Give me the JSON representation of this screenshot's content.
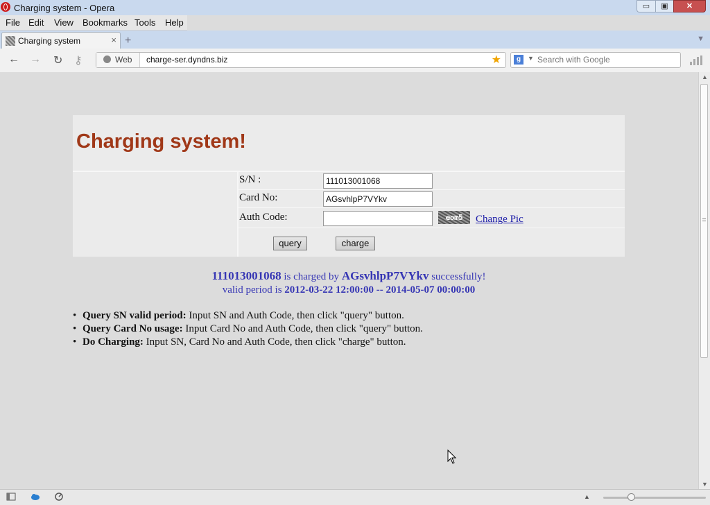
{
  "window": {
    "title": "Charging system - Opera",
    "minimize": "▭",
    "maximize": "▣",
    "close": "✕"
  },
  "menu": [
    "File",
    "Edit",
    "View",
    "Bookmarks",
    "Tools",
    "Help"
  ],
  "tab": {
    "title": "Charging system",
    "close": "×",
    "new_tab": "+"
  },
  "toolbar": {
    "back": "←",
    "forward": "→",
    "reload": "↻",
    "key": "⚷",
    "web_label": "Web",
    "url": "charge-ser.dyndns.biz",
    "star": "★",
    "search_engine": "g",
    "search_placeholder": "Search with Google"
  },
  "page": {
    "heading": "Charging system!",
    "form": {
      "sn_label": "S/N :",
      "sn_value": "111013001068",
      "card_label": "Card No:",
      "card_value": "AGsvhlpP7VYkv",
      "auth_label": "Auth Code:",
      "auth_value": "",
      "captcha_text": "eom5",
      "change_pic": "Change Pic",
      "query_button": "query",
      "charge_button": "charge"
    },
    "result": {
      "sn": "111013001068",
      "charged_by": "is charged by",
      "card": "AGsvhlpP7VYkv",
      "success": "successfully!",
      "valid_prefix": "valid period is",
      "valid_from": "2012-03-22 12:00:00",
      "valid_sep": "--",
      "valid_to": "2014-05-07 00:00:00"
    },
    "help": [
      {
        "title": "Query SN valid period:",
        "text": " Input SN and Auth Code, then click \"query\" button."
      },
      {
        "title": "Query Card No usage:",
        "text": " Input Card No and Auth Code, then click \"query\" button."
      },
      {
        "title": "Do Charging:",
        "text": " Input SN, Card No and Auth Code, then click \"charge\" button."
      }
    ]
  },
  "zoom": {
    "level": 0.25
  }
}
